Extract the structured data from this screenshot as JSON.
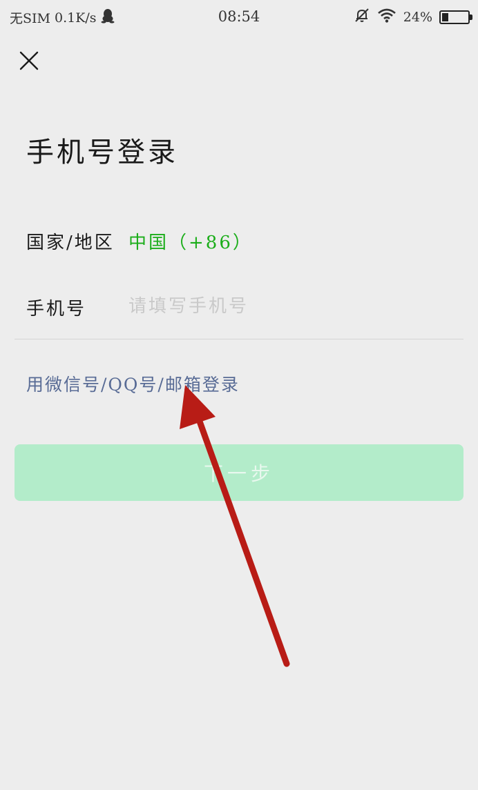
{
  "status_bar": {
    "carrier": "无SIM",
    "net_speed": "0.1K/s",
    "time": "08:54",
    "battery_percent": "24%",
    "battery_level": 0.24,
    "icons": [
      "qq-icon",
      "alarm-off-icon",
      "wifi-icon",
      "battery-icon"
    ]
  },
  "header": {
    "close_icon": "close-icon",
    "title": "手机号登录"
  },
  "form": {
    "country_label": "国家/地区",
    "country_value": "中国（+86）",
    "phone_label": "手机号",
    "phone_value": "",
    "phone_placeholder": "请填写手机号"
  },
  "alt_login": {
    "label": "用微信号/QQ号/邮箱登录"
  },
  "next_button": {
    "label": "下一步",
    "state": "disabled"
  },
  "annotation": {
    "type": "red-arrow",
    "color": "#b81c16"
  },
  "colors": {
    "background": "#ededed",
    "accent_green": "#1aad19",
    "link_blue": "#586b95",
    "button_disabled": "#b3ecca"
  }
}
